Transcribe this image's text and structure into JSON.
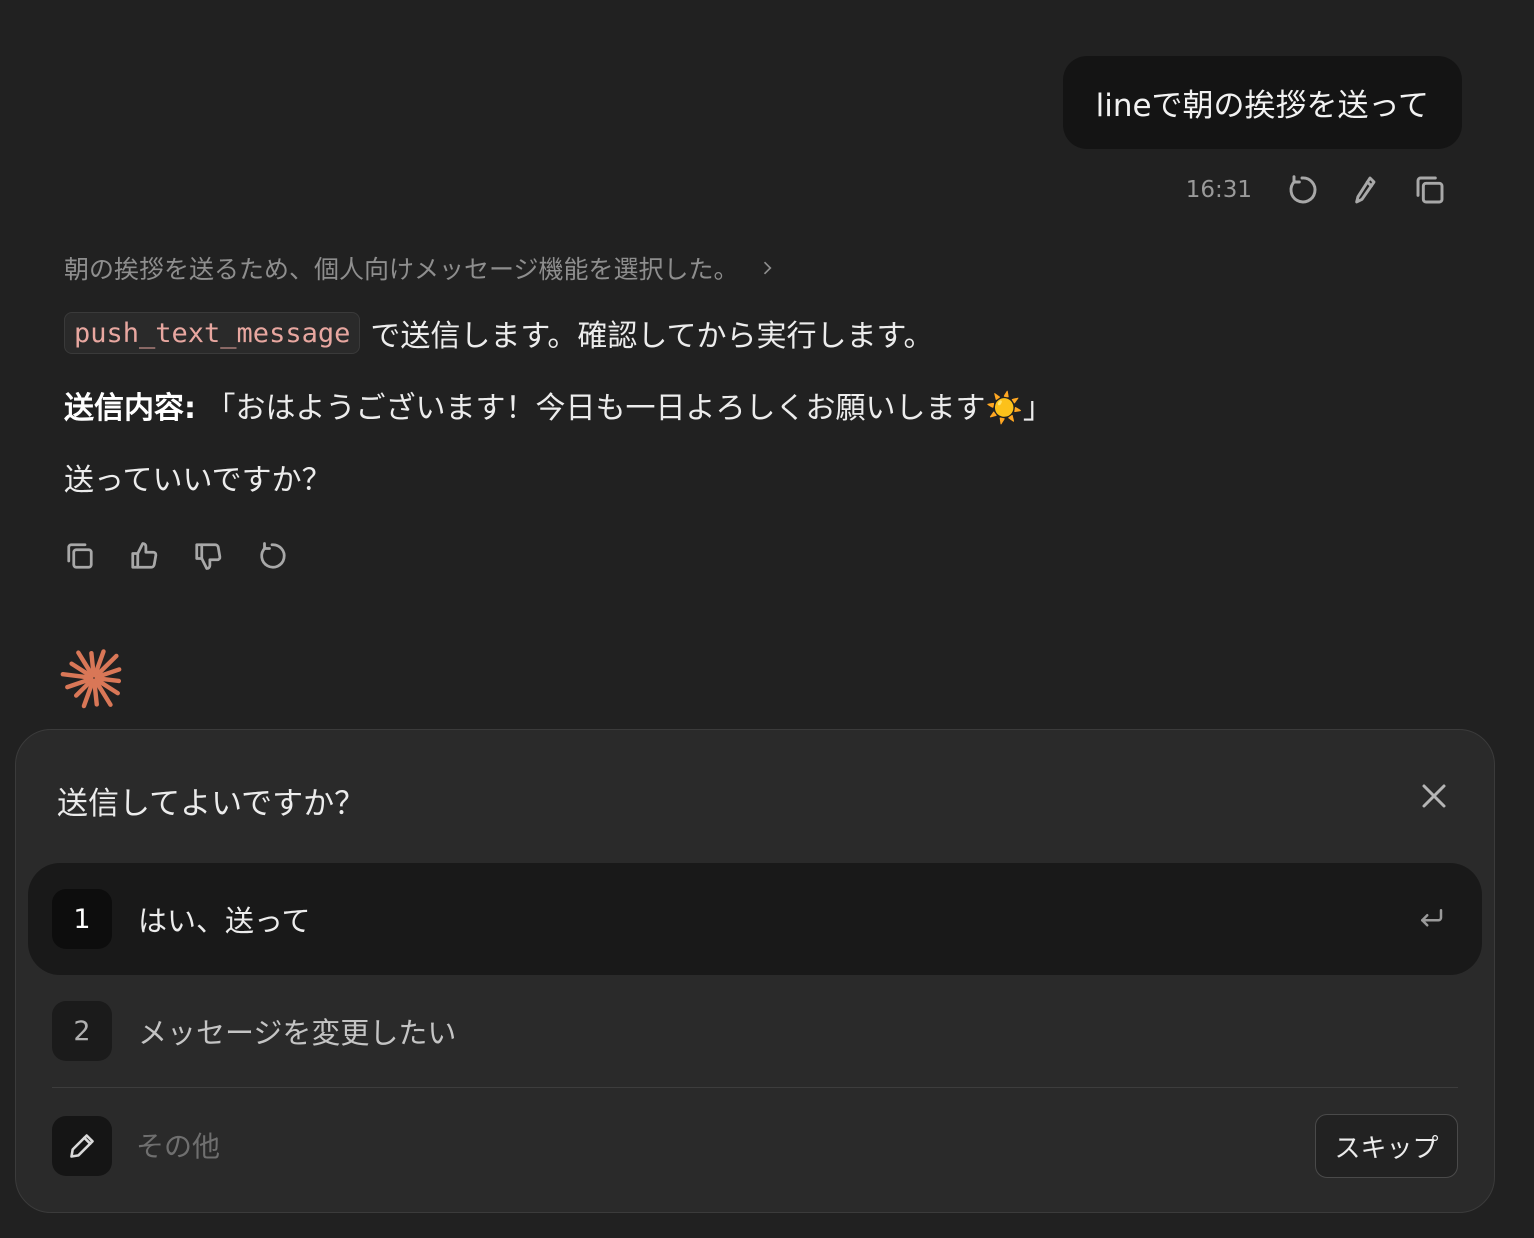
{
  "user_message": {
    "text": "lineで朝の挨拶を送って",
    "time": "16:31",
    "actions": [
      "retry-icon",
      "edit-icon",
      "copy-icon"
    ]
  },
  "assistant": {
    "thinking_summary": "朝の挨拶を送るため、個人向けメッセージ機能を選択した。",
    "tool_name": "push_text_message",
    "line1_rest": "で送信します。確認してから実行します。",
    "content_label": "送信内容:",
    "content_text": "「おはようございます！今日も一日よろしくお願いします☀️」",
    "question": "送っていいですか？",
    "actions": [
      "copy-icon",
      "thumbs-up-icon",
      "thumbs-down-icon",
      "retry-icon"
    ],
    "accent_color": "#d97757"
  },
  "dialog": {
    "title": "送信してよいですか？",
    "options": [
      {
        "number": "1",
        "label": "はい、送って"
      },
      {
        "number": "2",
        "label": "メッセージを変更したい"
      }
    ],
    "other_placeholder": "その他",
    "skip_label": "スキップ"
  }
}
